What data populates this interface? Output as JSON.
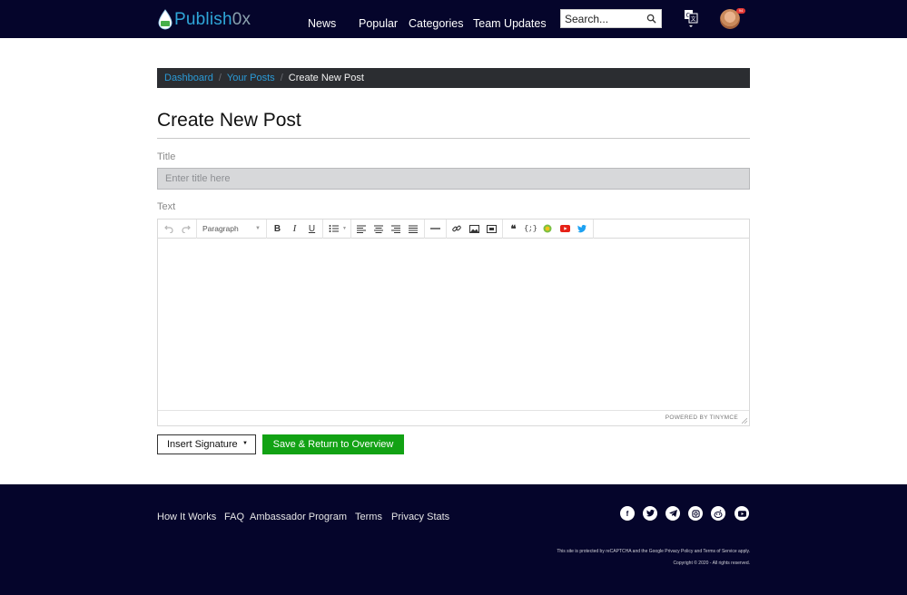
{
  "header": {
    "logo": {
      "brand": "Publish",
      "suffix": "0x"
    },
    "nav": [
      "News",
      "Popular",
      "Categories",
      "Team Updates"
    ],
    "search": {
      "placeholder": "Search..."
    },
    "avatar_badge": "94"
  },
  "breadcrumb": {
    "items": [
      "Dashboard",
      "Your Posts"
    ],
    "current": "Create New Post"
  },
  "page": {
    "title": "Create New Post",
    "title_label": "Title",
    "title_placeholder": "Enter title here",
    "text_label": "Text"
  },
  "editor": {
    "format_select": "Paragraph",
    "powered_by": "POWERED BY TINYMCE"
  },
  "actions": {
    "signature_label": "Insert Signature",
    "save_label": "Save & Return to Overview"
  },
  "footer": {
    "links": [
      "How It Works",
      "FAQ",
      "Ambassador Program",
      "Terms",
      "Privacy Stats"
    ],
    "recaptcha_notice": "This site is protected by reCAPTCHA and the Google Privacy Policy and Terms of Service apply.",
    "copyright": "Copyright © 2020 - All rights reserved.",
    "social_icons": [
      "facebook-icon",
      "twitter-icon",
      "telegram-icon",
      "instagram-icon",
      "reddit-icon",
      "youtube-icon"
    ]
  },
  "colors": {
    "header_bg": "#05052b",
    "accent_link": "#2b9ad6",
    "save_button": "#12a214",
    "breadcrumb_bg": "#2b2d31"
  }
}
